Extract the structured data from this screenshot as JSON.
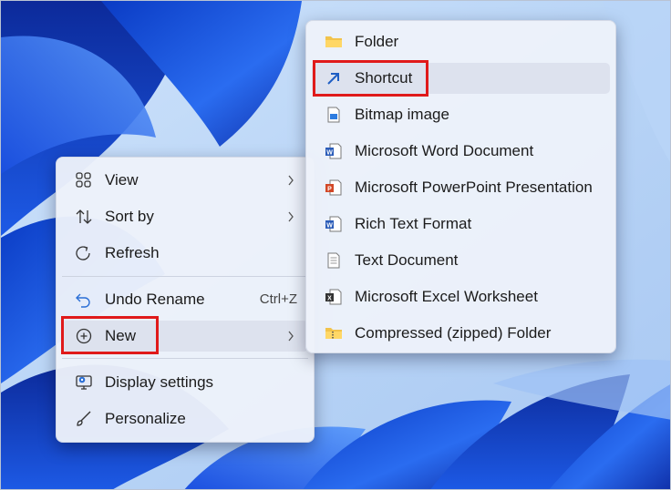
{
  "context_menu": {
    "items": [
      {
        "label": "View",
        "icon": "grid-view-icon"
      },
      {
        "label": "Sort by",
        "icon": "sort-icon"
      },
      {
        "label": "Refresh",
        "icon": "refresh-icon"
      },
      {
        "label": "Undo Rename",
        "icon": "undo-icon",
        "shortcut": "Ctrl+Z"
      },
      {
        "label": "New",
        "icon": "plus-circle-icon"
      },
      {
        "label": "Display settings",
        "icon": "display-settings-icon"
      },
      {
        "label": "Personalize",
        "icon": "brush-icon"
      }
    ]
  },
  "new_submenu": {
    "items": [
      {
        "label": "Folder",
        "icon": "folder-icon"
      },
      {
        "label": "Shortcut",
        "icon": "shortcut-icon"
      },
      {
        "label": "Bitmap image",
        "icon": "bitmap-icon"
      },
      {
        "label": "Microsoft Word Document",
        "icon": "word-doc-icon"
      },
      {
        "label": "Microsoft PowerPoint Presentation",
        "icon": "powerpoint-icon"
      },
      {
        "label": "Rich Text Format",
        "icon": "rtf-doc-icon"
      },
      {
        "label": "Text Document",
        "icon": "text-doc-icon"
      },
      {
        "label": "Microsoft Excel Worksheet",
        "icon": "excel-icon"
      },
      {
        "label": "Compressed (zipped) Folder",
        "icon": "zip-folder-icon"
      }
    ]
  },
  "colors": {
    "highlight_border": "#e01a1a",
    "wallpaper_blue": "#1f4fd6",
    "menu_bg": "#edf1fa",
    "hover_bg": "#dde2ee"
  }
}
